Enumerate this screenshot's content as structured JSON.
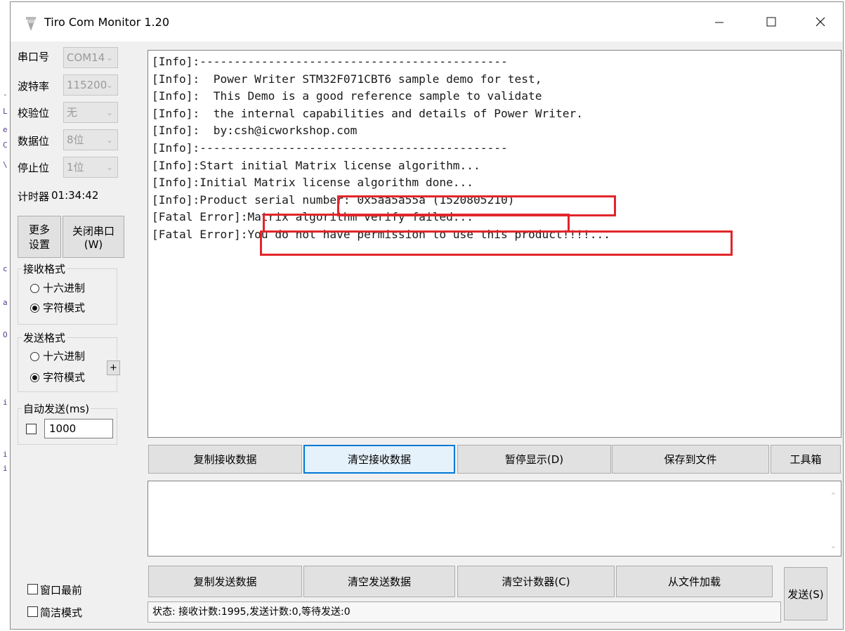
{
  "window": {
    "title": "Tiro Com Monitor 1.20"
  },
  "settings": {
    "port_label": "串口号",
    "port_value": "COM14",
    "baud_label": "波特率",
    "baud_value": "115200",
    "parity_label": "校验位",
    "parity_value": "无",
    "databits_label": "数据位",
    "databits_value": "8位",
    "stopbits_label": "停止位",
    "stopbits_value": "1位",
    "timer_label": "计时器",
    "timer_value": "01:34:42"
  },
  "buttons": {
    "more_line1": "更多",
    "more_line2": "设置",
    "close_line1": "关闭串口",
    "close_line2": "(W)"
  },
  "receive_format": {
    "title": "接收格式",
    "hex": "十六进制",
    "char": "字符模式"
  },
  "send_format": {
    "title": "发送格式",
    "hex": "十六进制",
    "char": "字符模式",
    "plus": "+"
  },
  "auto_send": {
    "title": "自动发送(ms)",
    "value": "1000"
  },
  "receive_log": {
    "lines": [
      "[Info]:---------------------------------------------",
      "[Info]:  Power Writer STM32F071CBT6 sample demo for test,",
      "[Info]:  This Demo is a good reference sample to validate",
      "[Info]:  the internal capabilities and details of Power Writer.",
      "[Info]:  by:csh@icworkshop.com",
      "[Info]:---------------------------------------------",
      "[Info]:Start initial Matrix license algorithm...",
      "[Info]:Initial Matrix license algorithm done...",
      "[Info]:Product serial number: 0x5aa5a55a (1520805210)",
      "[Fatal Error]:Matrix algorithm verify failed...",
      "[Fatal Error]:You do not have permission to use this product!!!!..."
    ]
  },
  "receive_buttons": {
    "copy": "复制接收数据",
    "clear": "清空接收数据",
    "pause": "暂停显示(D)",
    "save": "保存到文件",
    "tools": "工具箱"
  },
  "send_buttons": {
    "copy": "复制发送数据",
    "clear": "清空发送数据",
    "clear_counter": "清空计数器(C)",
    "load": "从文件加载",
    "send": "发送(S)"
  },
  "options": {
    "on_top": "窗口最前",
    "simple": "简洁模式"
  },
  "status": {
    "text": "状态: 接收计数:1995,发送计数:0,等待发送:0"
  },
  "colors": {
    "highlight": "#e2252a",
    "window_bg": "#f0f0f0",
    "focus_border": "#0078d7"
  }
}
